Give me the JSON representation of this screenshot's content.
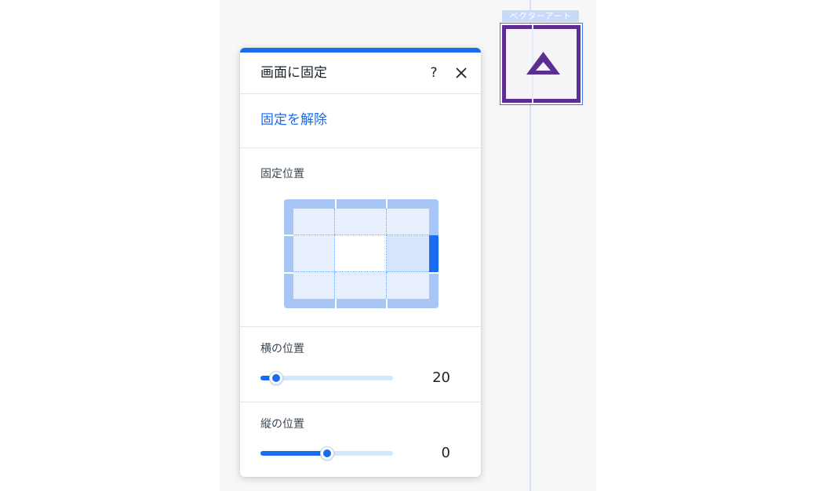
{
  "canvas": {
    "element_label": "ベクターアート",
    "element_color": "#5c2e91"
  },
  "panel": {
    "title": "画面に固定",
    "help_label": "?",
    "accent_color": "#1b6bf0",
    "unpin_label": "固定を解除",
    "position_label": "固定位置",
    "position_grid": {
      "rows": 3,
      "cols": 3,
      "selected_cell": "middle-right"
    },
    "horizontal": {
      "label": "横の位置",
      "value": "20",
      "fill_fraction": 0.12
    },
    "vertical": {
      "label": "縦の位置",
      "value": "0",
      "fill_fraction": 0.5
    },
    "icons": {
      "close": "close-icon",
      "element": "triangle-icon"
    }
  }
}
